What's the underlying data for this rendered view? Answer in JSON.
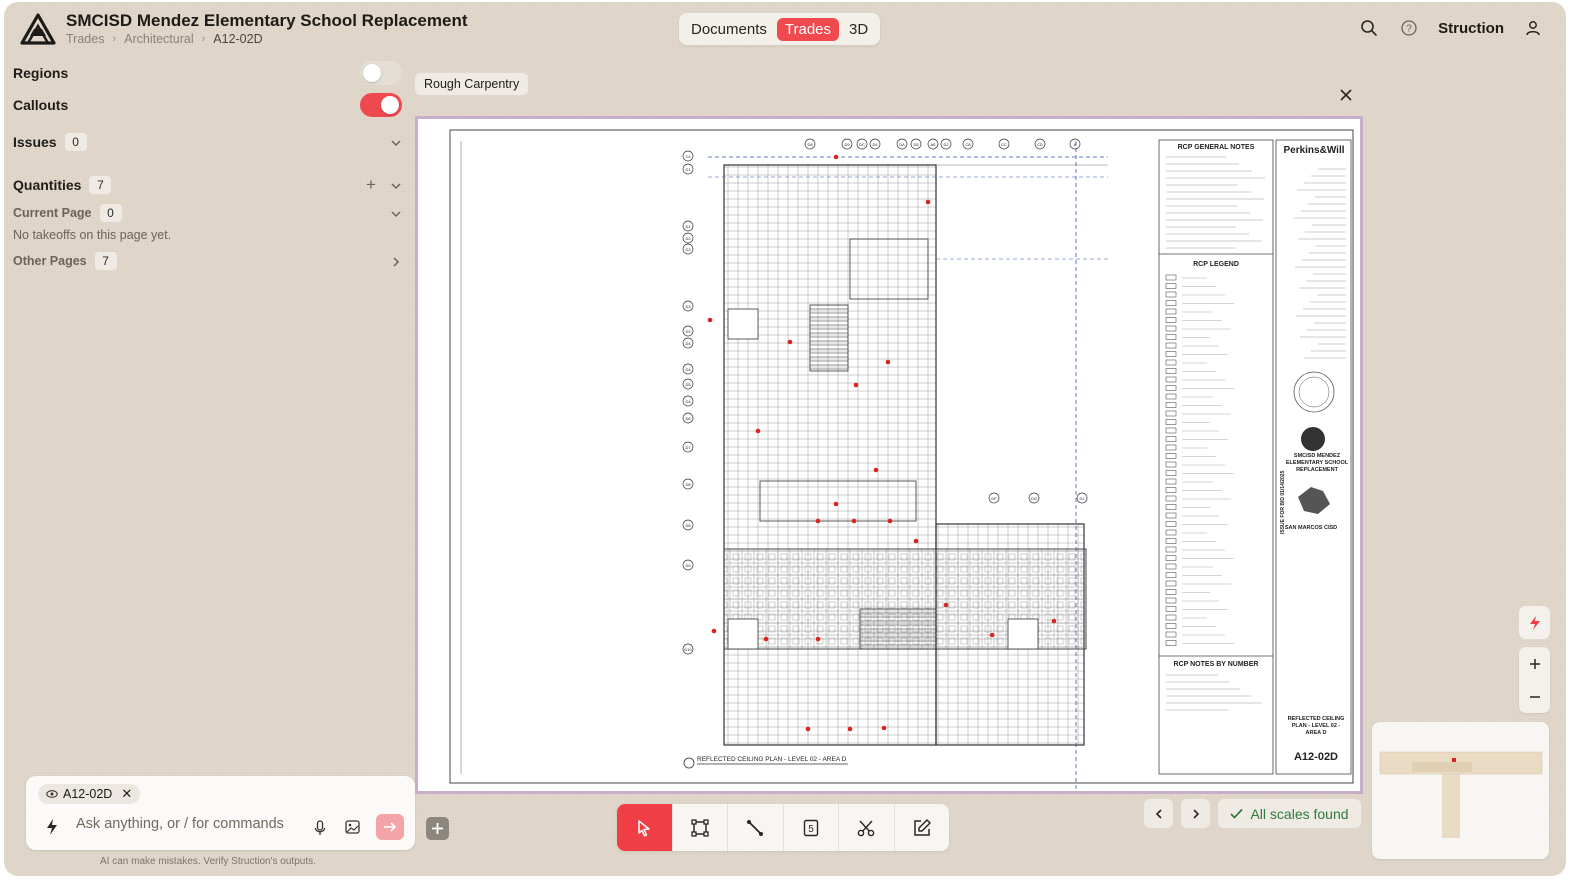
{
  "header": {
    "project_title": "SMCISD Mendez Elementary School Replacement",
    "breadcrumb": [
      "Trades",
      "Architectural",
      "A12-02D"
    ],
    "view_tabs": [
      {
        "label": "Documents",
        "active": false
      },
      {
        "label": "Trades",
        "active": true
      },
      {
        "label": "3D",
        "active": false
      }
    ],
    "brand": "Struction",
    "icons": [
      "search-icon",
      "help-icon",
      "user-icon"
    ]
  },
  "sidebar": {
    "regions": {
      "label": "Regions",
      "enabled": false
    },
    "callouts": {
      "label": "Callouts",
      "enabled": true
    },
    "issues": {
      "label": "Issues",
      "count": "0"
    },
    "quantities": {
      "label": "Quantities",
      "count": "7"
    },
    "current_page": {
      "label": "Current Page",
      "count": "0"
    },
    "empty_message": "No takeoffs on this page yet.",
    "other_pages": {
      "label": "Other Pages",
      "count": "7"
    }
  },
  "chat": {
    "context_chip": "A12-02D",
    "placeholder": "Ask anything, or / for commands",
    "disclaimer": "AI can make mistakes. Verify Struction's outputs."
  },
  "viewer": {
    "trade_tag": "Rough Carpentry",
    "sheet": {
      "plan_caption": "REFLECTED CEILING PLAN - LEVEL 02 - AREA D",
      "notes_title": "RCP GENERAL NOTES",
      "legend_title": "RCP LEGEND",
      "notes_by_number_title": "RCP NOTES BY NUMBER",
      "architect": "Perkins&Will",
      "project_block": [
        "SMCISD MENDEZ",
        "ELEMENTARY SCHOOL",
        "REPLACEMENT"
      ],
      "owner": "SAN MARCOS CISD",
      "sheet_title": [
        "REFLECTED CEILING",
        "PLAN - LEVEL 02 -",
        "AREA D"
      ],
      "sheet_number": "A12-02D",
      "issue_text": "ISSUE FOR BID 01/14/2025",
      "grid_top": [
        "D8",
        "D9",
        "DC",
        "D4",
        "DA",
        "D5",
        "AE",
        "D2",
        "C8",
        "CC",
        "CD",
        "A"
      ],
      "grid_left": [
        "C4",
        "D1",
        "D1",
        "D2",
        "D2",
        "D3",
        "D3",
        "D4",
        "D4",
        "D5",
        "D4",
        "D6",
        "D7",
        "D8",
        "D8",
        "D9",
        "D10"
      ],
      "grid_lower": [
        "DF",
        "DG",
        "DJ"
      ]
    }
  },
  "toolbar": {
    "tools": [
      "select-tool",
      "area-tool",
      "line-tool",
      "count-tool",
      "cut-tool",
      "edit-tool"
    ],
    "active_tool": "select-tool"
  },
  "pager": {
    "scales_status": "All scales found"
  },
  "colors": {
    "accent": "#ef3e45",
    "background": "#ddd3c6",
    "success": "#2f7a3d",
    "sheet_border": "#c7aec9"
  }
}
